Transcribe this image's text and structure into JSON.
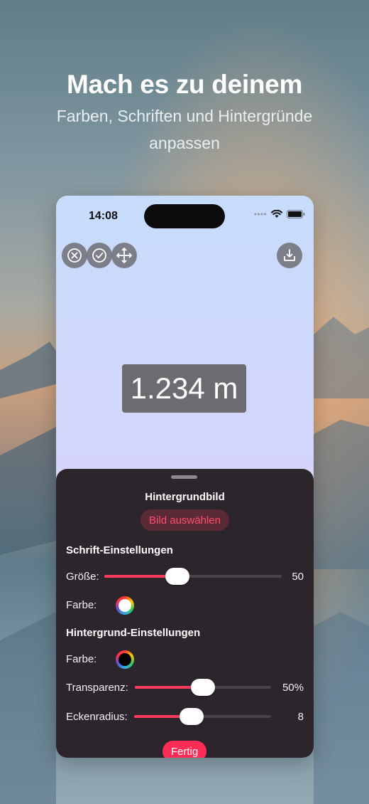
{
  "promo": {
    "headline": "Mach es zu deinem",
    "subline": "Farben, Schriften und Hintergründe anpassen"
  },
  "status_bar": {
    "time": "14:08"
  },
  "toolbar": {
    "close_icon": "close-icon",
    "confirm_icon": "checkmark-icon",
    "move_icon": "move-arrows-icon",
    "save_icon": "save-download-icon"
  },
  "display": {
    "value": "1.234 m"
  },
  "sheet": {
    "title": "Hintergrundbild",
    "pick_image_label": "Bild auswählen",
    "font_section": {
      "title": "Schrift-Einstellungen",
      "size_label": "Größe:",
      "size_value": "50",
      "size_fraction": 0.41,
      "color_label": "Farbe:",
      "color": "#ffffff"
    },
    "background_section": {
      "title": "Hintergrund-Einstellungen",
      "color_label": "Farbe:",
      "color": "#000000",
      "transparency_label": "Transparenz:",
      "transparency_value": "50%",
      "transparency_fraction": 0.5,
      "corner_radius_label": "Eckenradius:",
      "corner_radius_value": "8",
      "corner_radius_fraction": 0.42
    },
    "done_label": "Fertig"
  },
  "colors": {
    "accent": "#ff2d55",
    "sheet_background": "#2c252c"
  }
}
